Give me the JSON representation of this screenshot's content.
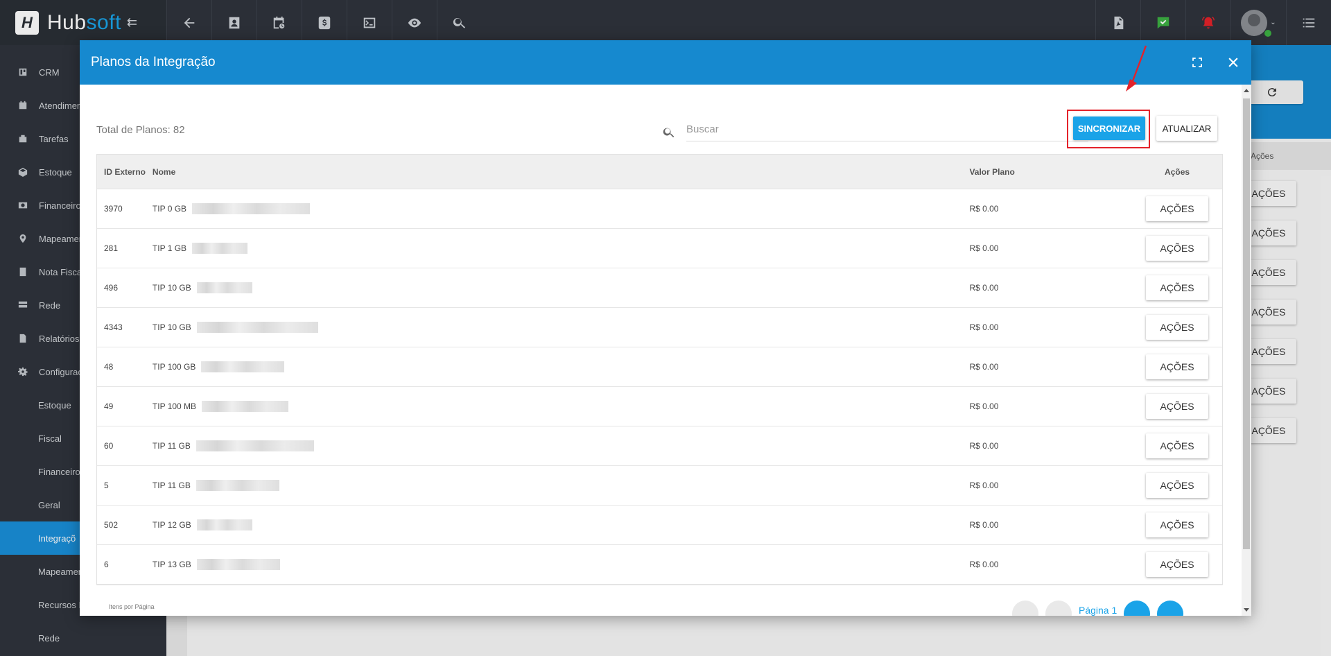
{
  "app": {
    "logo_mark": "H",
    "logo_text_a": "Hub",
    "logo_text_b": "soft",
    "collapse_glyph": "⇇"
  },
  "toolbar": {
    "left_icons": [
      "back-arrow-icon",
      "contact-card-icon",
      "calendar-clock-icon",
      "dollar-icon",
      "terminal-icon",
      "eye-icon",
      "search-icon"
    ],
    "right_icons": [
      "pdf-icon",
      "chat-check-icon",
      "alarm-bell-icon"
    ],
    "colors": {
      "chat": "#3cb043",
      "alarm": "#e4222a"
    }
  },
  "sidebar": {
    "items": [
      {
        "label": "CRM",
        "icon": "crm-icon"
      },
      {
        "label": "Atendimen",
        "icon": "calendar-icon"
      },
      {
        "label": "Tarefas",
        "icon": "tasks-icon"
      },
      {
        "label": "Estoque",
        "icon": "box-icon"
      },
      {
        "label": "Financeiro",
        "icon": "money-icon"
      },
      {
        "label": "Mapeamen",
        "icon": "map-pin-icon"
      },
      {
        "label": "Nota Fisca",
        "icon": "document-icon"
      },
      {
        "label": "Rede",
        "icon": "server-icon"
      },
      {
        "label": "Relatórios",
        "icon": "report-icon"
      },
      {
        "label": "Configurac",
        "icon": "gear-icon"
      }
    ],
    "subitems": [
      {
        "label": "Estoque",
        "active": false
      },
      {
        "label": "Fiscal",
        "active": false
      },
      {
        "label": "Financeiro",
        "active": false
      },
      {
        "label": "Geral",
        "active": false
      },
      {
        "label": "Integraçõ",
        "active": true
      },
      {
        "label": "Mapeamen",
        "active": false
      },
      {
        "label": "Recursos I",
        "active": false
      },
      {
        "label": "Rede",
        "active": false
      }
    ]
  },
  "background": {
    "acoes_header": "Ações",
    "acoes_label": "AÇÕES"
  },
  "modal": {
    "title": "Planos da Integração",
    "total_label": "Total de Planos: 82",
    "search_placeholder": "Buscar",
    "sync_label": "SINCRONIZAR",
    "update_label": "ATUALIZAR",
    "columns": {
      "id": "ID Externo",
      "nome": "Nome",
      "valor": "Valor Plano",
      "acoes": "Ações"
    },
    "rows": [
      {
        "id": "3970",
        "nome": "TIP 0 GB",
        "valor": "R$ 0.00",
        "acoes": "AÇÕES"
      },
      {
        "id": "281",
        "nome": "TIP 1 GB",
        "valor": "R$ 0.00",
        "acoes": "AÇÕES"
      },
      {
        "id": "496",
        "nome": "TIP 10 GB",
        "valor": "R$ 0.00",
        "acoes": "AÇÕES"
      },
      {
        "id": "4343",
        "nome": "TIP 10 GB",
        "valor": "R$ 0.00",
        "acoes": "AÇÕES"
      },
      {
        "id": "48",
        "nome": "TIP 100 GB",
        "valor": "R$ 0.00",
        "acoes": "AÇÕES"
      },
      {
        "id": "49",
        "nome": "TIP 100 MB",
        "valor": "R$ 0.00",
        "acoes": "AÇÕES"
      },
      {
        "id": "60",
        "nome": "TIP 11 GB",
        "valor": "R$ 0.00",
        "acoes": "AÇÕES"
      },
      {
        "id": "5",
        "nome": "TIP 11 GB",
        "valor": "R$ 0.00",
        "acoes": "AÇÕES"
      },
      {
        "id": "502",
        "nome": "TIP 12 GB",
        "valor": "R$ 0.00",
        "acoes": "AÇÕES"
      },
      {
        "id": "6",
        "nome": "TIP 13 GB",
        "valor": "R$ 0.00",
        "acoes": "AÇÕES"
      }
    ],
    "items_per_page_label": "Itens por Página",
    "pager_text": "Página 1"
  }
}
